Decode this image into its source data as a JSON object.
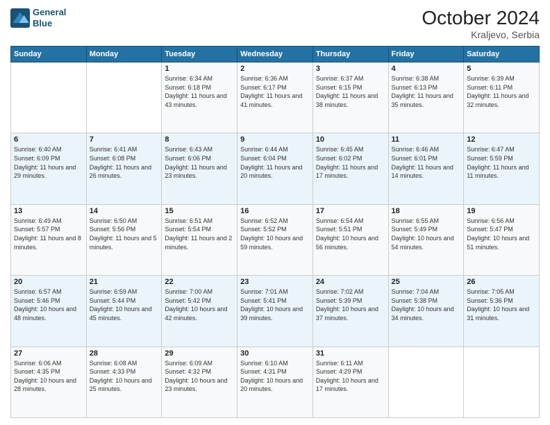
{
  "header": {
    "logo_line1": "General",
    "logo_line2": "Blue",
    "title": "October 2024",
    "subtitle": "Kraljevo, Serbia"
  },
  "weekdays": [
    "Sunday",
    "Monday",
    "Tuesday",
    "Wednesday",
    "Thursday",
    "Friday",
    "Saturday"
  ],
  "weeks": [
    [
      {
        "day": "",
        "sunrise": "",
        "sunset": "",
        "daylight": ""
      },
      {
        "day": "",
        "sunrise": "",
        "sunset": "",
        "daylight": ""
      },
      {
        "day": "1",
        "sunrise": "Sunrise: 6:34 AM",
        "sunset": "Sunset: 6:18 PM",
        "daylight": "Daylight: 11 hours and 43 minutes."
      },
      {
        "day": "2",
        "sunrise": "Sunrise: 6:36 AM",
        "sunset": "Sunset: 6:17 PM",
        "daylight": "Daylight: 11 hours and 41 minutes."
      },
      {
        "day": "3",
        "sunrise": "Sunrise: 6:37 AM",
        "sunset": "Sunset: 6:15 PM",
        "daylight": "Daylight: 11 hours and 38 minutes."
      },
      {
        "day": "4",
        "sunrise": "Sunrise: 6:38 AM",
        "sunset": "Sunset: 6:13 PM",
        "daylight": "Daylight: 11 hours and 35 minutes."
      },
      {
        "day": "5",
        "sunrise": "Sunrise: 6:39 AM",
        "sunset": "Sunset: 6:11 PM",
        "daylight": "Daylight: 11 hours and 32 minutes."
      }
    ],
    [
      {
        "day": "6",
        "sunrise": "Sunrise: 6:40 AM",
        "sunset": "Sunset: 6:09 PM",
        "daylight": "Daylight: 11 hours and 29 minutes."
      },
      {
        "day": "7",
        "sunrise": "Sunrise: 6:41 AM",
        "sunset": "Sunset: 6:08 PM",
        "daylight": "Daylight: 11 hours and 26 minutes."
      },
      {
        "day": "8",
        "sunrise": "Sunrise: 6:43 AM",
        "sunset": "Sunset: 6:06 PM",
        "daylight": "Daylight: 11 hours and 23 minutes."
      },
      {
        "day": "9",
        "sunrise": "Sunrise: 6:44 AM",
        "sunset": "Sunset: 6:04 PM",
        "daylight": "Daylight: 11 hours and 20 minutes."
      },
      {
        "day": "10",
        "sunrise": "Sunrise: 6:45 AM",
        "sunset": "Sunset: 6:02 PM",
        "daylight": "Daylight: 11 hours and 17 minutes."
      },
      {
        "day": "11",
        "sunrise": "Sunrise: 6:46 AM",
        "sunset": "Sunset: 6:01 PM",
        "daylight": "Daylight: 11 hours and 14 minutes."
      },
      {
        "day": "12",
        "sunrise": "Sunrise: 6:47 AM",
        "sunset": "Sunset: 5:59 PM",
        "daylight": "Daylight: 11 hours and 11 minutes."
      }
    ],
    [
      {
        "day": "13",
        "sunrise": "Sunrise: 6:49 AM",
        "sunset": "Sunset: 5:57 PM",
        "daylight": "Daylight: 11 hours and 8 minutes."
      },
      {
        "day": "14",
        "sunrise": "Sunrise: 6:50 AM",
        "sunset": "Sunset: 5:56 PM",
        "daylight": "Daylight: 11 hours and 5 minutes."
      },
      {
        "day": "15",
        "sunrise": "Sunrise: 6:51 AM",
        "sunset": "Sunset: 5:54 PM",
        "daylight": "Daylight: 11 hours and 2 minutes."
      },
      {
        "day": "16",
        "sunrise": "Sunrise: 6:52 AM",
        "sunset": "Sunset: 5:52 PM",
        "daylight": "Daylight: 10 hours and 59 minutes."
      },
      {
        "day": "17",
        "sunrise": "Sunrise: 6:54 AM",
        "sunset": "Sunset: 5:51 PM",
        "daylight": "Daylight: 10 hours and 56 minutes."
      },
      {
        "day": "18",
        "sunrise": "Sunrise: 6:55 AM",
        "sunset": "Sunset: 5:49 PM",
        "daylight": "Daylight: 10 hours and 54 minutes."
      },
      {
        "day": "19",
        "sunrise": "Sunrise: 6:56 AM",
        "sunset": "Sunset: 5:47 PM",
        "daylight": "Daylight: 10 hours and 51 minutes."
      }
    ],
    [
      {
        "day": "20",
        "sunrise": "Sunrise: 6:57 AM",
        "sunset": "Sunset: 5:46 PM",
        "daylight": "Daylight: 10 hours and 48 minutes."
      },
      {
        "day": "21",
        "sunrise": "Sunrise: 6:59 AM",
        "sunset": "Sunset: 5:44 PM",
        "daylight": "Daylight: 10 hours and 45 minutes."
      },
      {
        "day": "22",
        "sunrise": "Sunrise: 7:00 AM",
        "sunset": "Sunset: 5:42 PM",
        "daylight": "Daylight: 10 hours and 42 minutes."
      },
      {
        "day": "23",
        "sunrise": "Sunrise: 7:01 AM",
        "sunset": "Sunset: 5:41 PM",
        "daylight": "Daylight: 10 hours and 39 minutes."
      },
      {
        "day": "24",
        "sunrise": "Sunrise: 7:02 AM",
        "sunset": "Sunset: 5:39 PM",
        "daylight": "Daylight: 10 hours and 37 minutes."
      },
      {
        "day": "25",
        "sunrise": "Sunrise: 7:04 AM",
        "sunset": "Sunset: 5:38 PM",
        "daylight": "Daylight: 10 hours and 34 minutes."
      },
      {
        "day": "26",
        "sunrise": "Sunrise: 7:05 AM",
        "sunset": "Sunset: 5:36 PM",
        "daylight": "Daylight: 10 hours and 31 minutes."
      }
    ],
    [
      {
        "day": "27",
        "sunrise": "Sunrise: 6:06 AM",
        "sunset": "Sunset: 4:35 PM",
        "daylight": "Daylight: 10 hours and 28 minutes."
      },
      {
        "day": "28",
        "sunrise": "Sunrise: 6:08 AM",
        "sunset": "Sunset: 4:33 PM",
        "daylight": "Daylight: 10 hours and 25 minutes."
      },
      {
        "day": "29",
        "sunrise": "Sunrise: 6:09 AM",
        "sunset": "Sunset: 4:32 PM",
        "daylight": "Daylight: 10 hours and 23 minutes."
      },
      {
        "day": "30",
        "sunrise": "Sunrise: 6:10 AM",
        "sunset": "Sunset: 4:31 PM",
        "daylight": "Daylight: 10 hours and 20 minutes."
      },
      {
        "day": "31",
        "sunrise": "Sunrise: 6:11 AM",
        "sunset": "Sunset: 4:29 PM",
        "daylight": "Daylight: 10 hours and 17 minutes."
      },
      {
        "day": "",
        "sunrise": "",
        "sunset": "",
        "daylight": ""
      },
      {
        "day": "",
        "sunrise": "",
        "sunset": "",
        "daylight": ""
      }
    ]
  ]
}
